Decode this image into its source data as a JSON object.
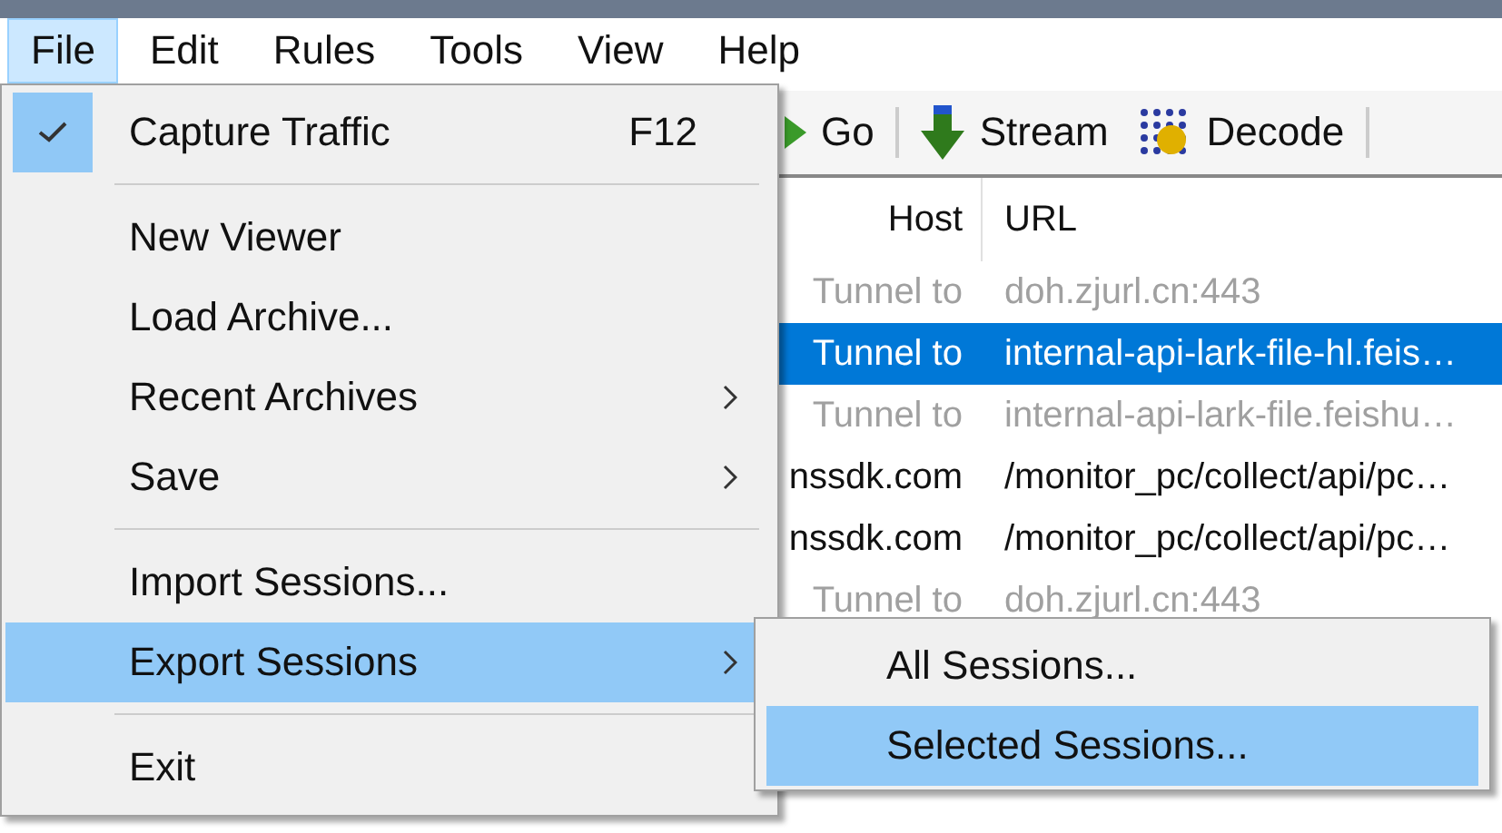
{
  "menubar": [
    {
      "label": "File",
      "selected": true
    },
    {
      "label": "Edit",
      "selected": false
    },
    {
      "label": "Rules",
      "selected": false
    },
    {
      "label": "Tools",
      "selected": false
    },
    {
      "label": "View",
      "selected": false
    },
    {
      "label": "Help",
      "selected": false
    }
  ],
  "toolbar": [
    {
      "kind": "go",
      "label": "Go"
    },
    {
      "kind": "separator"
    },
    {
      "kind": "stream",
      "label": "Stream"
    },
    {
      "kind": "decode",
      "label": "Decode"
    },
    {
      "kind": "separator"
    }
  ],
  "table": {
    "columns": [
      "Host",
      "URL"
    ],
    "rows": [
      {
        "kind": "tunnel",
        "host": "Tunnel to",
        "url": "doh.zjurl.cn:443",
        "selected": false
      },
      {
        "kind": "tunnel",
        "host": "Tunnel to",
        "url": "internal-api-lark-file-hl.feis…",
        "selected": true
      },
      {
        "kind": "tunnel",
        "host": "Tunnel to",
        "url": "internal-api-lark-file.feishu…",
        "selected": false
      },
      {
        "kind": "request",
        "host": "nssdk.com",
        "url": "/monitor_pc/collect/api/pc…",
        "selected": false
      },
      {
        "kind": "request",
        "host": "nssdk.com",
        "url": "/monitor_pc/collect/api/pc…",
        "selected": false
      },
      {
        "kind": "tunnel",
        "host": "Tunnel to",
        "url": "doh.zjurl.cn:443",
        "selected": false
      }
    ]
  },
  "file_menu": [
    {
      "kind": "item",
      "label": "Capture Traffic",
      "shortcut": "F12",
      "checked": true,
      "selected": false,
      "submenu": false
    },
    {
      "kind": "separator"
    },
    {
      "kind": "item",
      "label": "New Viewer",
      "checked": false,
      "selected": false,
      "submenu": false
    },
    {
      "kind": "item",
      "label": "Load Archive...",
      "checked": false,
      "selected": false,
      "submenu": false
    },
    {
      "kind": "item",
      "label": "Recent Archives",
      "checked": false,
      "selected": false,
      "submenu": true
    },
    {
      "kind": "item",
      "label": "Save",
      "checked": false,
      "selected": false,
      "submenu": true
    },
    {
      "kind": "separator"
    },
    {
      "kind": "item",
      "label": "Import Sessions...",
      "checked": false,
      "selected": false,
      "submenu": false
    },
    {
      "kind": "item",
      "label": "Export Sessions",
      "checked": false,
      "selected": true,
      "submenu": true
    },
    {
      "kind": "separator"
    },
    {
      "kind": "item",
      "label": "Exit",
      "checked": false,
      "selected": false,
      "submenu": false
    }
  ],
  "export_submenu": [
    {
      "label": "All Sessions...",
      "selected": false
    },
    {
      "label": "Selected Sessions...",
      "selected": true
    }
  ]
}
